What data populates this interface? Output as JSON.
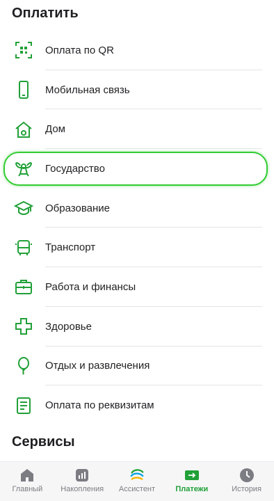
{
  "sections": {
    "pay_title": "Оплатить",
    "services_title": "Сервисы"
  },
  "pay_items": [
    {
      "label": "Оплата по QR",
      "icon": "qr-code-icon"
    },
    {
      "label": "Мобильная связь",
      "icon": "smartphone-icon"
    },
    {
      "label": "Дом",
      "icon": "home-icon"
    },
    {
      "label": "Государство",
      "icon": "coat-of-arms-icon"
    },
    {
      "label": "Образование",
      "icon": "graduation-cap-icon"
    },
    {
      "label": "Транспорт",
      "icon": "bus-icon"
    },
    {
      "label": "Работа и финансы",
      "icon": "briefcase-icon"
    },
    {
      "label": "Здоровье",
      "icon": "medical-cross-icon"
    },
    {
      "label": "Отдых и развлечения",
      "icon": "balloon-icon"
    },
    {
      "label": "Оплата по реквизитам",
      "icon": "document-icon"
    }
  ],
  "tabs": [
    {
      "label": "Главный",
      "icon": "home-tab-icon"
    },
    {
      "label": "Накопления",
      "icon": "chart-tab-icon"
    },
    {
      "label": "Ассистент",
      "icon": "assistant-logo-icon"
    },
    {
      "label": "Платежи",
      "icon": "payments-tab-icon"
    },
    {
      "label": "История",
      "icon": "clock-tab-icon"
    }
  ],
  "highlighted_item": "Государство",
  "active_tab": "Платежи",
  "colors": {
    "accent": "#21a038",
    "highlight": "#33cc33"
  }
}
